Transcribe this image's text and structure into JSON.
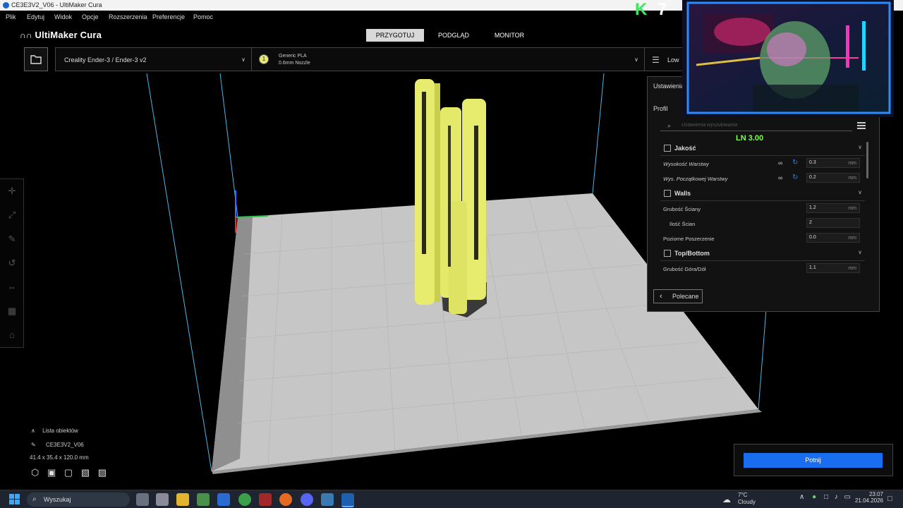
{
  "window": {
    "title": "CE3E3V2_V06 - UltiMaker Cura"
  },
  "menu": [
    "Plik",
    "Edytuj",
    "Widok",
    "Opcje",
    "Rozszerzenia",
    "Preferencje",
    "Pomoc"
  ],
  "header": {
    "logo": "UltiMaker Cura",
    "stages": [
      {
        "label": "PRZYGOTUJ",
        "active": true
      },
      {
        "label": "PODGLĄD",
        "active": false
      },
      {
        "label": "MONITOR",
        "active": false
      }
    ]
  },
  "toolbar": {
    "printer": "Creality Ender-3 / Ender-3 v2",
    "extruder_number": "1",
    "material": "Generic PLA",
    "nozzle": "0.6mm Nozzle",
    "profile_short": "Low"
  },
  "left_tools": [
    "move-icon",
    "scale-icon",
    "rotate-icon",
    "undo-rotate-icon",
    "mirror-icon",
    "per-model-settings-icon",
    "support-blocker-icon"
  ],
  "objects": {
    "header": "Lista obiektów",
    "name": "CE3E3V2_V06",
    "dimensions": "41.4 x 35.4 x 120.0 mm"
  },
  "settings": {
    "header": "Ustawienia",
    "profile_label": "Profil",
    "search_placeholder": "Ustawienia wyszukiwania",
    "categories": {
      "quality": "Jakość",
      "walls": "Walls",
      "topbottom": "Top/Bottom"
    },
    "rows": {
      "layer_height": {
        "label": "Wysokość Warstwy",
        "value": "0.3",
        "unit": "mm"
      },
      "initial_layer": {
        "label": "Wys. Początkowej Warstwy",
        "value": "0.2",
        "unit": "mm"
      },
      "wall_thickness": {
        "label": "Grubość Ściany",
        "value": "1.2",
        "unit": "mm"
      },
      "wall_count": {
        "label": "Ilość Ścian",
        "value": "2"
      },
      "horizontal_expansion": {
        "label": "Poziome Poszerzenie",
        "value": "0.0",
        "unit": "mm"
      },
      "topbottom_thickness": {
        "label": "Grubość Góra/Dół",
        "value": "1.1",
        "unit": "mm"
      }
    },
    "recommended_button": "Polecane"
  },
  "overlay": {
    "ln_text": "LN 3.00",
    "k_letter": "K",
    "k_number": "7"
  },
  "slice": {
    "button": "Potnij"
  },
  "taskbar": {
    "search": "Wyszukaj",
    "weather_temp": "7°C",
    "weather_desc": "Cloudy",
    "time": "23:07",
    "date": "21.04.2026"
  },
  "colors": {
    "accent": "#196ef0",
    "model": "#e7ec6f",
    "buildplate": "#c4c4c4",
    "ln_text": "#7dff4d"
  }
}
